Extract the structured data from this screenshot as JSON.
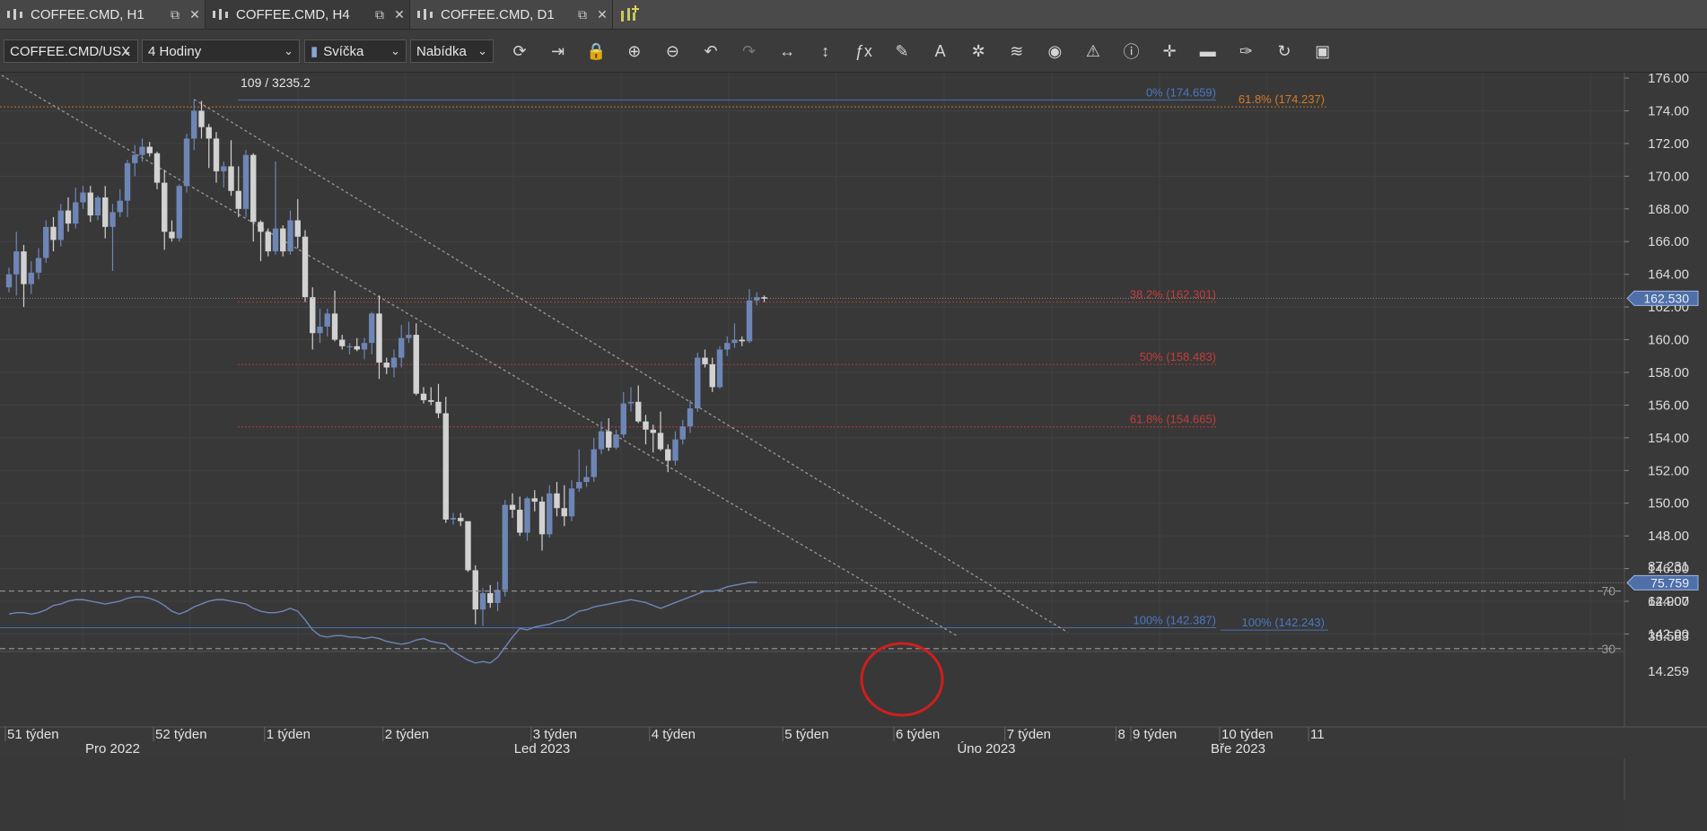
{
  "tabs": [
    {
      "label": "COFFEE.CMD, H1",
      "active": false
    },
    {
      "label": "COFFEE.CMD, H4",
      "active": true
    },
    {
      "label": "COFFEE.CMD, D1",
      "active": false
    }
  ],
  "toolbar": {
    "symbol": "COFFEE.CMD/USX",
    "timeframe": "4 Hodiny",
    "chart_type": "Svíčka",
    "price_side": "Nabídka",
    "icons": [
      "refresh-icon",
      "autoscroll-icon",
      "lock-icon",
      "zoom-in-icon",
      "zoom-out-icon",
      "undo-icon",
      "redo-icon",
      "horizontal-expand-icon",
      "vertical-expand-icon",
      "indicator-fx-icon",
      "pencil-icon",
      "text-icon",
      "tools-icon",
      "layers-icon",
      "eye-icon",
      "chart-alert-icon",
      "info-icon",
      "crosshair-icon",
      "volume-icon",
      "paint-icon",
      "reset-icon",
      "save-icon"
    ]
  },
  "colors": {
    "bull": "#6e86b6",
    "bear": "#d2d2d2",
    "fib_red": "#c43c3c",
    "fib_blue": "#4a78c4",
    "fib_orange": "#d47a28",
    "rsi_line": "#6e86b6"
  },
  "chart_data": {
    "type": "candlestick",
    "title": "109 / 3235.2",
    "y_ticks": [
      "176.00",
      "174.00",
      "172.00",
      "170.00",
      "168.00",
      "166.00",
      "164.00",
      "162.00",
      "160.00",
      "158.00",
      "156.00",
      "154.00",
      "152.00",
      "150.00",
      "148.00",
      "146.00",
      "144.00",
      "142.00"
    ],
    "ylim": [
      141.3,
      176.2
    ],
    "current_price": "162.530",
    "candles": [
      [
        163.2,
        164.4,
        162.9,
        164.0
      ],
      [
        164.0,
        166.6,
        162.7,
        165.4
      ],
      [
        165.4,
        165.8,
        162.0,
        163.4
      ],
      [
        163.4,
        164.8,
        162.8,
        164.1
      ],
      [
        164.1,
        165.6,
        163.7,
        165.0
      ],
      [
        165.0,
        167.3,
        164.7,
        166.9
      ],
      [
        166.9,
        167.5,
        165.4,
        166.1
      ],
      [
        166.1,
        168.3,
        165.7,
        167.9
      ],
      [
        167.9,
        168.7,
        166.6,
        167.1
      ],
      [
        167.1,
        169.3,
        166.8,
        168.4
      ],
      [
        168.4,
        169.4,
        168.0,
        169.0
      ],
      [
        169.0,
        169.4,
        167.2,
        167.6
      ],
      [
        167.6,
        168.8,
        167.3,
        168.7
      ],
      [
        168.7,
        169.4,
        166.2,
        166.9
      ],
      [
        166.9,
        168.3,
        164.2,
        167.8
      ],
      [
        167.8,
        169.2,
        167.5,
        168.5
      ],
      [
        168.5,
        171.0,
        167.5,
        170.8
      ],
      [
        170.8,
        171.9,
        170.0,
        171.3
      ],
      [
        171.3,
        172.3,
        170.9,
        171.8
      ],
      [
        171.8,
        172.1,
        171.2,
        171.4
      ],
      [
        171.4,
        171.5,
        169.2,
        169.6
      ],
      [
        169.6,
        170.4,
        165.5,
        166.6
      ],
      [
        166.6,
        167.3,
        166.0,
        166.2
      ],
      [
        166.2,
        169.5,
        166.0,
        169.4
      ],
      [
        169.4,
        172.6,
        169.0,
        172.3
      ],
      [
        172.3,
        174.7,
        171.6,
        174.0
      ],
      [
        174.0,
        174.6,
        172.3,
        173.0
      ],
      [
        173.0,
        173.2,
        170.5,
        172.3
      ],
      [
        172.3,
        172.7,
        169.6,
        170.3
      ],
      [
        170.3,
        170.9,
        169.3,
        170.6
      ],
      [
        170.6,
        172.2,
        168.8,
        169.1
      ],
      [
        169.1,
        170.6,
        167.5,
        168.0
      ],
      [
        168.0,
        171.6,
        167.5,
        171.3
      ],
      [
        171.3,
        171.4,
        166.0,
        167.2
      ],
      [
        167.2,
        167.3,
        164.8,
        166.6
      ],
      [
        166.6,
        166.8,
        165.1,
        165.4
      ],
      [
        165.4,
        170.9,
        165.2,
        166.8
      ],
      [
        166.8,
        167.0,
        165.1,
        165.4
      ],
      [
        165.4,
        167.9,
        165.2,
        167.3
      ],
      [
        167.3,
        168.6,
        165.6,
        166.3
      ],
      [
        166.3,
        166.7,
        162.3,
        162.6
      ],
      [
        162.6,
        163.2,
        159.4,
        160.4
      ],
      [
        160.4,
        161.9,
        159.8,
        160.8
      ],
      [
        160.8,
        161.9,
        160.2,
        161.6
      ],
      [
        161.6,
        163.0,
        159.9,
        160.0
      ],
      [
        160.0,
        160.3,
        159.4,
        159.6
      ],
      [
        159.6,
        159.8,
        159.1,
        159.6
      ],
      [
        159.6,
        160.1,
        159.3,
        159.4
      ],
      [
        159.4,
        160.1,
        158.8,
        159.8
      ],
      [
        159.8,
        161.7,
        159.1,
        161.6
      ],
      [
        161.6,
        162.7,
        157.6,
        158.6
      ],
      [
        158.6,
        158.9,
        157.9,
        158.3
      ],
      [
        158.3,
        159.4,
        157.7,
        158.9
      ],
      [
        158.9,
        160.9,
        158.3,
        160.1
      ],
      [
        160.1,
        161.1,
        159.8,
        160.3
      ],
      [
        160.3,
        161.0,
        156.6,
        156.7
      ],
      [
        156.7,
        157.1,
        156.1,
        156.3
      ],
      [
        156.3,
        157.1,
        156.0,
        156.2
      ],
      [
        156.2,
        157.3,
        155.2,
        155.5
      ],
      [
        155.5,
        156.5,
        148.8,
        149.0
      ],
      [
        149.0,
        149.4,
        148.7,
        149.1
      ],
      [
        149.1,
        149.4,
        148.6,
        148.9
      ],
      [
        148.9,
        148.5,
        145.8,
        145.9
      ],
      [
        145.9,
        146.2,
        142.6,
        143.5
      ],
      [
        143.5,
        144.8,
        142.5,
        144.5
      ],
      [
        144.5,
        145.0,
        143.6,
        143.9
      ],
      [
        143.9,
        145.2,
        143.4,
        144.7
      ],
      [
        144.7,
        150.2,
        144.3,
        149.9
      ],
      [
        149.9,
        150.6,
        149.1,
        149.6
      ],
      [
        149.6,
        150.4,
        148.0,
        148.2
      ],
      [
        148.2,
        150.4,
        147.7,
        150.3
      ],
      [
        150.3,
        150.8,
        149.5,
        150.1
      ],
      [
        150.1,
        150.4,
        147.1,
        148.1
      ],
      [
        148.1,
        151.1,
        147.9,
        150.6
      ],
      [
        150.6,
        151.3,
        149.2,
        149.7
      ],
      [
        149.7,
        151.1,
        148.6,
        149.2
      ],
      [
        149.2,
        151.4,
        148.9,
        150.9
      ],
      [
        150.9,
        153.3,
        150.7,
        151.3
      ],
      [
        151.3,
        152.3,
        151.0,
        151.6
      ],
      [
        151.6,
        154.0,
        151.3,
        153.3
      ],
      [
        153.3,
        155.0,
        153.0,
        154.4
      ],
      [
        154.4,
        155.2,
        153.2,
        153.4
      ],
      [
        153.4,
        154.5,
        153.3,
        154.2
      ],
      [
        154.2,
        156.8,
        154.0,
        156.1
      ],
      [
        156.1,
        157.1,
        155.6,
        156.2
      ],
      [
        156.2,
        157.2,
        154.9,
        155.0
      ],
      [
        155.0,
        155.4,
        153.6,
        154.5
      ],
      [
        154.5,
        154.8,
        153.1,
        154.3
      ],
      [
        154.3,
        155.6,
        153.2,
        153.3
      ],
      [
        153.3,
        153.6,
        151.9,
        152.6
      ],
      [
        152.6,
        154.4,
        152.3,
        153.9
      ],
      [
        153.9,
        155.1,
        153.6,
        154.7
      ],
      [
        154.7,
        156.3,
        154.3,
        155.8
      ],
      [
        155.8,
        159.2,
        155.6,
        158.9
      ],
      [
        158.9,
        159.4,
        158.3,
        158.5
      ],
      [
        158.5,
        158.9,
        156.8,
        157.1
      ],
      [
        157.1,
        159.6,
        157.0,
        159.4
      ],
      [
        159.4,
        160.2,
        159.0,
        159.8
      ],
      [
        159.8,
        161.0,
        159.5,
        160.0
      ],
      [
        160.0,
        160.2,
        159.6,
        159.9
      ],
      [
        159.9,
        163.1,
        159.8,
        162.4
      ],
      [
        162.4,
        162.9,
        162.1,
        162.6
      ],
      [
        162.6,
        162.7,
        162.3,
        162.5
      ]
    ],
    "fib": [
      {
        "label": "0% (174.659)",
        "value": 174.659,
        "color": "blue"
      },
      {
        "label": "61.8% (174.237)",
        "value": 174.237,
        "color": "orange"
      },
      {
        "label": "38.2% (162.301)",
        "value": 162.301,
        "color": "red"
      },
      {
        "label": "50% (158.483)",
        "value": 158.483,
        "color": "red"
      },
      {
        "label": "61.8% (154.665)",
        "value": 154.665,
        "color": "red"
      },
      {
        "label": "100% (142.387)",
        "value": 142.387,
        "color": "blue"
      },
      {
        "label": "100% (142.243)",
        "value": 142.243,
        "color": "blue"
      }
    ],
    "trendlines": [
      {
        "from": [
          -6,
          177.5
        ],
        "to": [
          128,
          141.9
        ]
      },
      {
        "from": [
          25,
          174.7
        ],
        "to": [
          143,
          142.1
        ]
      }
    ],
    "rsi": {
      "y_ticks": [
        "87.231",
        "62.907",
        "38.583",
        "14.259"
      ],
      "levels": [
        "70",
        "30"
      ],
      "current": "75.759",
      "values": [
        54,
        55,
        55,
        54,
        55,
        57,
        60,
        61,
        63,
        64,
        64,
        63,
        62,
        61,
        62,
        63,
        65,
        66,
        66,
        65,
        63,
        60,
        56,
        54,
        56,
        59,
        61,
        63,
        64,
        64,
        63,
        62,
        61,
        58,
        56,
        55,
        55,
        56,
        58,
        56,
        50,
        43,
        39,
        38,
        39,
        39,
        38,
        38,
        37,
        38,
        37,
        35,
        34,
        33,
        34,
        36,
        37,
        35,
        34,
        33,
        28,
        25,
        22,
        20,
        21,
        20,
        24,
        31,
        38,
        44,
        43,
        45,
        46,
        47,
        49,
        50,
        53,
        56,
        57,
        59,
        60,
        61,
        62,
        63,
        64,
        63,
        62,
        60,
        58,
        60,
        62,
        64,
        66,
        68,
        70,
        70,
        71,
        73,
        74,
        75,
        76,
        76
      ]
    },
    "x_labels": [
      {
        "text": "51 týden",
        "idx": 0
      },
      {
        "text": "52 týden",
        "idx": 20
      },
      {
        "text": "1 týden",
        "idx": 35
      },
      {
        "text": "2 týden",
        "idx": 51
      },
      {
        "text": "3 týden",
        "idx": 71
      },
      {
        "text": "4 týden",
        "idx": 87
      },
      {
        "text": "5 týden",
        "idx": 105
      },
      {
        "text": "6 týden",
        "idx": 120
      },
      {
        "text": "7 týden",
        "idx": 135
      },
      {
        "text": "8",
        "idx": 150
      },
      {
        "text": "9 týden",
        "idx": 152
      },
      {
        "text": "10 týden",
        "idx": 164
      },
      {
        "text": "11",
        "idx": 176
      }
    ],
    "month_labels": [
      {
        "text": "Pro 2022",
        "idx": 14
      },
      {
        "text": "Led 2023",
        "idx": 72
      },
      {
        "text": "Úno 2023",
        "idx": 132
      },
      {
        "text": "Bře 2023",
        "idx": 166
      }
    ]
  }
}
